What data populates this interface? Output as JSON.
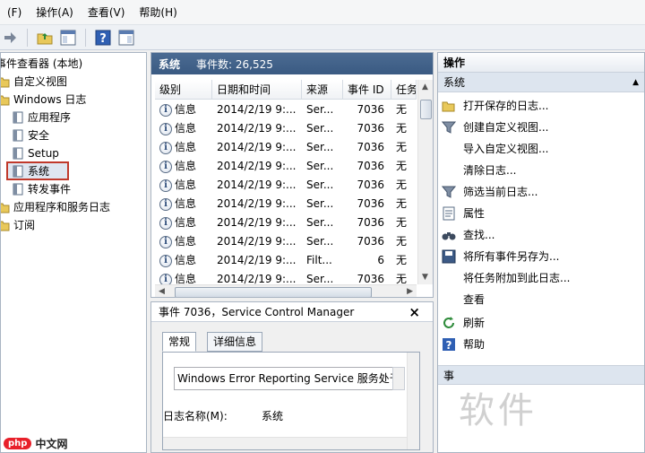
{
  "menu": {
    "items": [
      "(F)",
      "操作(A)",
      "查看(V)",
      "帮助(H)"
    ]
  },
  "toolbar": {
    "buttons": [
      "back-icon",
      "forward-icon",
      "folder-up-icon",
      "console-tree-icon",
      "help-icon",
      "show-pane-icon"
    ]
  },
  "tree": {
    "root": "事件查看器 (本地)",
    "items": [
      {
        "label": "自定义视图",
        "icon": "folder-icon"
      },
      {
        "label": "Windows 日志",
        "icon": "folder-icon"
      },
      {
        "label": "应用程序",
        "icon": "log-icon"
      },
      {
        "label": "安全",
        "icon": "log-icon"
      },
      {
        "label": "Setup",
        "icon": "log-icon"
      },
      {
        "label": "系统",
        "icon": "log-icon"
      },
      {
        "label": "转发事件",
        "icon": "log-icon"
      },
      {
        "label": "应用程序和服务日志",
        "icon": "folder-icon"
      },
      {
        "label": "订阅",
        "icon": "folder-icon"
      }
    ]
  },
  "events": {
    "title": "系统",
    "count_label": "事件数: 26,525",
    "columns": [
      "级别",
      "日期和时间",
      "来源",
      "事件 ID",
      "任务"
    ],
    "rows": [
      [
        "信息",
        "2014/2/19 9:...",
        "Ser...",
        "7036",
        "无"
      ],
      [
        "信息",
        "2014/2/19 9:...",
        "Ser...",
        "7036",
        "无"
      ],
      [
        "信息",
        "2014/2/19 9:...",
        "Ser...",
        "7036",
        "无"
      ],
      [
        "信息",
        "2014/2/19 9:...",
        "Ser...",
        "7036",
        "无"
      ],
      [
        "信息",
        "2014/2/19 9:...",
        "Ser...",
        "7036",
        "无"
      ],
      [
        "信息",
        "2014/2/19 9:...",
        "Ser...",
        "7036",
        "无"
      ],
      [
        "信息",
        "2014/2/19 9:...",
        "Ser...",
        "7036",
        "无"
      ],
      [
        "信息",
        "2014/2/19 9:...",
        "Ser...",
        "7036",
        "无"
      ],
      [
        "信息",
        "2014/2/19 9:...",
        "Filt...",
        "6",
        "无"
      ],
      [
        "信息",
        "2014/2/19 9:...",
        "Ser...",
        "7036",
        "无"
      ]
    ]
  },
  "detail": {
    "title": "事件 7036，Service Control Manager",
    "tabs": [
      "常规",
      "详细信息"
    ],
    "description": "Windows Error Reporting Service 服务处于 (",
    "log_name_label": "日志名称(M):",
    "log_name_value": "系统"
  },
  "actions": {
    "header": "操作",
    "section": "系统",
    "items": [
      {
        "label": "打开保存的日志...",
        "icon": "open-folder-icon"
      },
      {
        "label": "创建自定义视图...",
        "icon": "filter-icon"
      },
      {
        "label": "导入自定义视图...",
        "icon": ""
      },
      {
        "label": "清除日志...",
        "icon": ""
      },
      {
        "label": "筛选当前日志...",
        "icon": "filter-icon"
      },
      {
        "label": "属性",
        "icon": "properties-icon"
      },
      {
        "label": "查找...",
        "icon": "binoculars-icon"
      },
      {
        "label": "将所有事件另存为...",
        "icon": "save-icon"
      },
      {
        "label": "将任务附加到此日志...",
        "icon": ""
      },
      {
        "label": "查看",
        "icon": ""
      },
      {
        "label": "刷新",
        "icon": "refresh-icon"
      },
      {
        "label": "帮助",
        "icon": "help-icon"
      }
    ],
    "section2": "事"
  },
  "watermark": "软件",
  "logo": {
    "badge": "php",
    "text": "中文网"
  }
}
